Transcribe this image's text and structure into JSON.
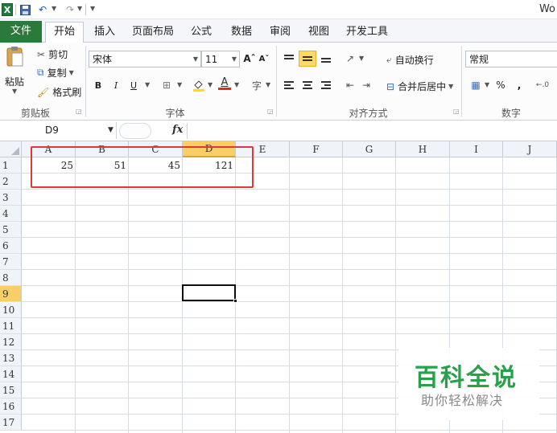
{
  "window": {
    "title": "Wo"
  },
  "tabs": [
    "文件",
    "开始",
    "插入",
    "页面布局",
    "公式",
    "数据",
    "审阅",
    "视图",
    "开发工具"
  ],
  "ribbon": {
    "clipboard": {
      "paste": "粘贴",
      "cut": "剪切",
      "copy": "复制",
      "format_painter": "格式刷",
      "label": "剪贴板"
    },
    "font": {
      "name": "宋体",
      "size": "11",
      "bold": "B",
      "italic": "I",
      "underline": "U",
      "grow": "Aˆ",
      "shrink": "Aˇ",
      "label": "字体"
    },
    "alignment": {
      "wrap_text": "自动换行",
      "merge_center": "合并后居中",
      "label": "对齐方式"
    },
    "number": {
      "format": "常规",
      "percent": "%",
      "comma": ",",
      "label": "数字"
    }
  },
  "formula_bar": {
    "name_box": "D9",
    "fx": "fx",
    "value": ""
  },
  "grid": {
    "columns": [
      "A",
      "B",
      "C",
      "D",
      "E",
      "F",
      "G",
      "H",
      "I",
      "J"
    ],
    "rows": [
      "1",
      "2",
      "3",
      "4",
      "5",
      "6",
      "7",
      "8",
      "9",
      "10",
      "11",
      "12",
      "13",
      "14",
      "15",
      "16",
      "17"
    ],
    "selected_cell": "D9",
    "row1_values": {
      "A": "25",
      "B": "51",
      "C": "45",
      "D": "121"
    }
  },
  "watermark": {
    "title": "百科全说",
    "subtitle": "助你轻松解决"
  },
  "colors": {
    "file_tab": "#2a7a3a",
    "selected_header": "#f8cf66",
    "highlight_box": "#e0383a",
    "watermark_green": "#2aa04a"
  }
}
